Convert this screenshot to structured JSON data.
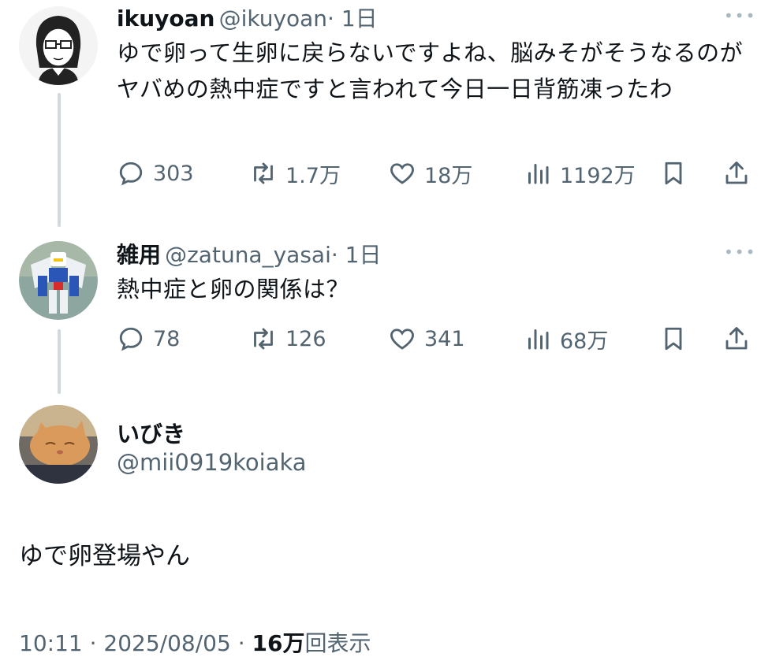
{
  "colors": {
    "text": "#0f1419",
    "secondary": "#536471",
    "thread_line": "#cfd9de"
  },
  "tweets": [
    {
      "name": "ikuyoan",
      "handle": "@ikuyoan",
      "time": "· 1日",
      "text": "ゆで卵って生卵に戻らないですよね、脳みそがそうなるのがヤバめの熱中症ですと言われて今日一日背筋凍ったわ",
      "replies": "303",
      "retweets": "1.7万",
      "likes": "18万",
      "views": "1192万",
      "avatar_icon": "glasses-person-avatar"
    },
    {
      "name": "雑用",
      "handle": "@zatuna_yasai",
      "time": "· 1日",
      "text": "熱中症と卵の関係は？",
      "replies": "78",
      "retweets": "126",
      "likes": "341",
      "views": "68万",
      "avatar_icon": "robot-figure-avatar"
    }
  ],
  "main": {
    "name": "いびき",
    "handle": "@mii0919koiaka",
    "text": "ゆで卵登場やん",
    "avatar_icon": "cat-avatar"
  },
  "footer": {
    "time": "10:11",
    "sep1": "·",
    "date": "2025/08/05",
    "sep2": "·",
    "views_count": "16万",
    "views_label": "回表示"
  }
}
